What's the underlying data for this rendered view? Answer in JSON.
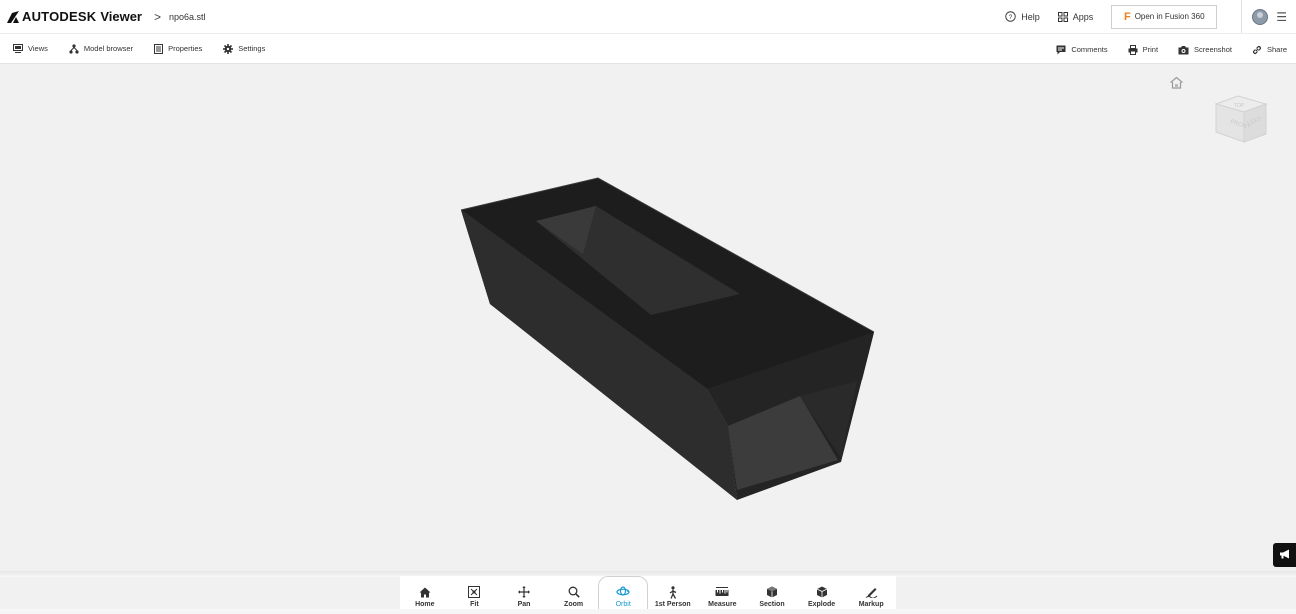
{
  "header": {
    "brand": "AUTODESK",
    "product": "Viewer",
    "breadcrumb_sep": ">",
    "file_name": "npo6a.stl",
    "help_label": "Help",
    "apps_label": "Apps",
    "fusion_label": "Open in Fusion 360"
  },
  "toolbar": {
    "left": [
      {
        "label": "Views",
        "icon": "views-icon"
      },
      {
        "label": "Model browser",
        "icon": "model-browser-icon"
      },
      {
        "label": "Properties",
        "icon": "properties-icon"
      },
      {
        "label": "Settings",
        "icon": "settings-gear-icon"
      }
    ],
    "right": [
      {
        "label": "Comments",
        "icon": "comments-icon"
      },
      {
        "label": "Print",
        "icon": "print-icon"
      },
      {
        "label": "Screenshot",
        "icon": "camera-icon"
      },
      {
        "label": "Share",
        "icon": "share-link-icon"
      }
    ]
  },
  "tools": [
    {
      "label": "Home",
      "icon": "home-icon"
    },
    {
      "label": "Fit",
      "icon": "fit-icon"
    },
    {
      "label": "Pan",
      "icon": "pan-icon"
    },
    {
      "label": "Zoom",
      "icon": "zoom-icon"
    },
    {
      "label": "Orbit",
      "icon": "orbit-icon",
      "active": true
    },
    {
      "label": "1st Person",
      "icon": "first-person-icon"
    },
    {
      "label": "Measure",
      "icon": "measure-icon"
    },
    {
      "label": "Section",
      "icon": "section-icon"
    },
    {
      "label": "Explode",
      "icon": "explode-icon"
    },
    {
      "label": "Markup",
      "icon": "markup-icon"
    }
  ],
  "colors": {
    "accent": "#1a9ad6",
    "fusion": "#f07c1a",
    "canvas": "#f1f1f1",
    "model": "#1c1c1c"
  }
}
